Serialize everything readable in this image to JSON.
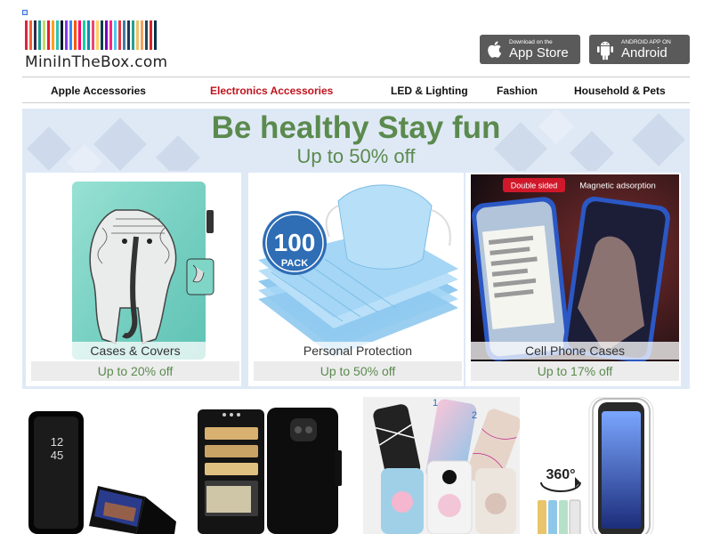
{
  "brand": {
    "name": "MiniInTheBox.com",
    "stripe_colors": [
      "#d7263d",
      "#f46036",
      "#2e294e",
      "#1b998b",
      "#c5d86d",
      "#e71d36",
      "#ff9f1c",
      "#2ec4b6",
      "#011627",
      "#8338ec",
      "#3a86ff",
      "#fb5607",
      "#ff006e",
      "#06d6a0",
      "#118ab2",
      "#ef476f",
      "#ffd166",
      "#073b4c",
      "#7209b7",
      "#f72585",
      "#4cc9f0",
      "#e63946",
      "#457b9d",
      "#1d3557",
      "#2a9d8f",
      "#e9c46a",
      "#f4a261",
      "#264653",
      "#d62828",
      "#003049"
    ]
  },
  "app_badges": {
    "appstore": {
      "small": "Download on the",
      "big": "App Store"
    },
    "android": {
      "small": "ANDROID APP ON",
      "big": "Android"
    }
  },
  "nav": {
    "items": [
      {
        "label": "Apple Accessories"
      },
      {
        "label": "Electronics Accessories"
      },
      {
        "label": "LED & Lighting"
      },
      {
        "label": "Fashion"
      },
      {
        "label": "Household & Pets"
      }
    ],
    "active_color": "#c0121b"
  },
  "banner": {
    "headline": "Be healthy Stay fun",
    "subline": "Up to 50% off",
    "accent_color": "#5b8a4e",
    "cards": [
      {
        "caption": "Cases & Covers",
        "discount": "Up to 20% off"
      },
      {
        "caption": "Personal Protection",
        "discount": "Up to 50% off",
        "pack_count": "100",
        "pack_label": "PACK"
      },
      {
        "caption": "Cell Phone Cases",
        "discount": "Up to 17% off",
        "tag_double": "Double sided",
        "tag_magnetic": "Magnetic adsorption"
      }
    ]
  },
  "products": [
    {
      "icon": "mirror-flip-case",
      "clock_hour": "12",
      "clock_min": "45"
    },
    {
      "icon": "wallet-case"
    },
    {
      "icon": "marble-popsocket-cases",
      "marker_1": "1",
      "marker_2": "2"
    },
    {
      "icon": "clear-360-case",
      "badge": "360°"
    }
  ]
}
